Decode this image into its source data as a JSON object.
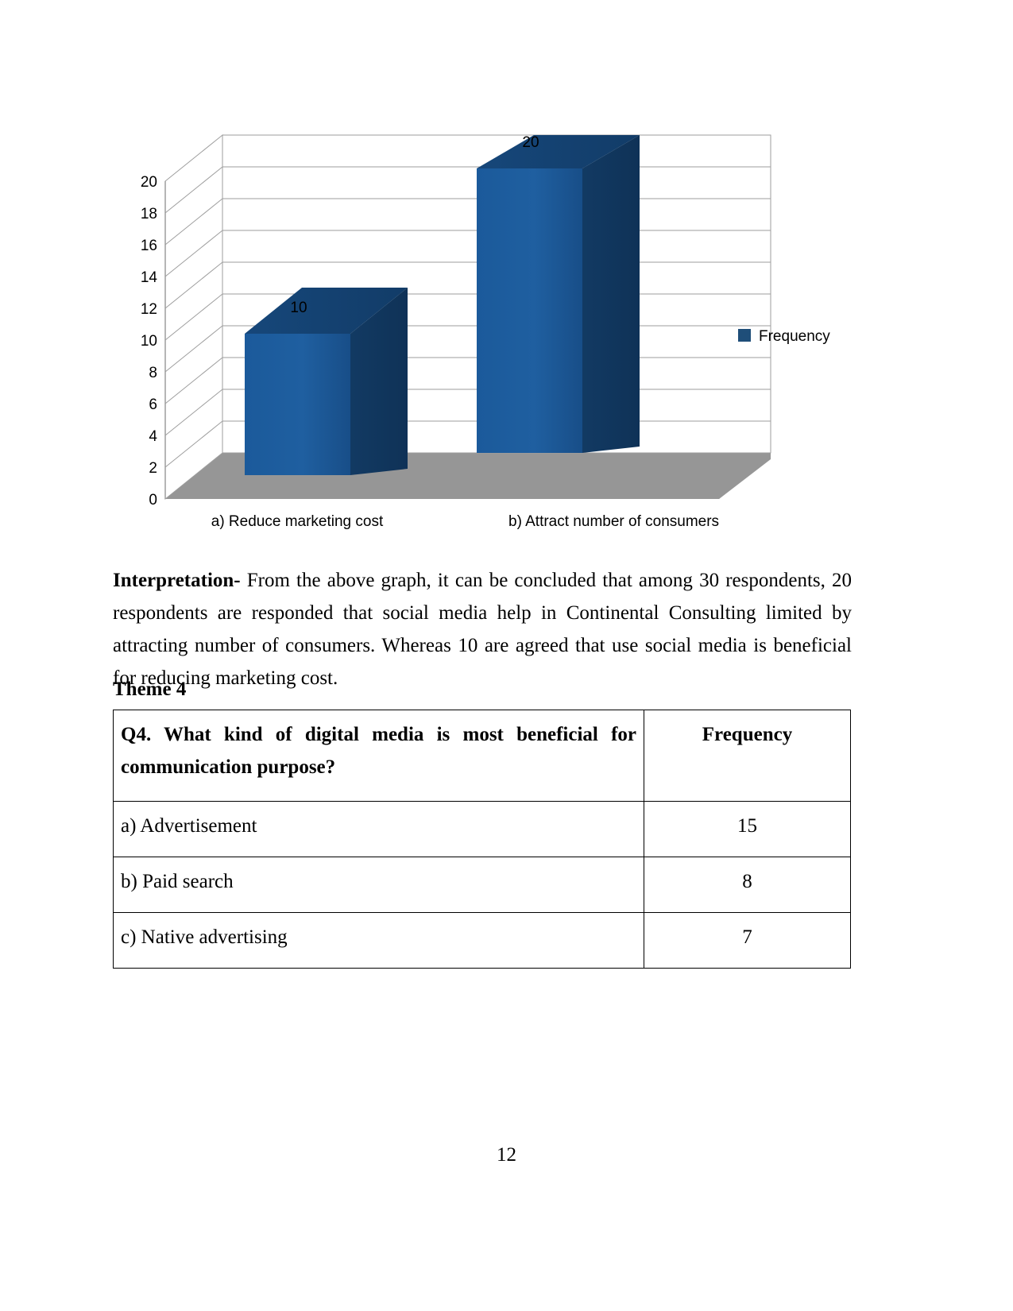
{
  "chart_data": {
    "type": "bar",
    "title": "",
    "subtitle": "",
    "xlabel": "",
    "ylabel": "",
    "categories": [
      "a) Reduce marketing cost",
      "b) Attract number of consumers"
    ],
    "values": [
      10,
      20
    ],
    "data_labels": [
      "10",
      "20"
    ],
    "series": [
      {
        "name": "Frequency",
        "values": [
          10,
          20
        ]
      }
    ],
    "legend": {
      "entries": [
        "Frequency"
      ],
      "position": "right"
    },
    "ylim": [
      0,
      20
    ],
    "yticks": [
      0,
      2,
      4,
      6,
      8,
      10,
      12,
      14,
      16,
      18,
      20
    ],
    "ytick_labels": [
      "0",
      "2",
      "4",
      "6",
      "8",
      "10",
      "12",
      "14",
      "16",
      "18",
      "20"
    ],
    "grid": true,
    "three_d": true,
    "colors": {
      "bar_front": "#1F5FA0",
      "bar_side": "#14406E",
      "bar_top": "#17497E",
      "floor": "#969696",
      "gridline": "#9E9E9E",
      "legend_marker": "#1F4E79"
    }
  },
  "legend": {
    "series_label": "Frequency"
  },
  "interpretation": {
    "label": "Interpretation-",
    "body": " From the above graph, it can be concluded that among 30 respondents, 20 respondents are responded that social media help in Continental Consulting limited by attracting number of consumers. Whereas 10 are agreed that use social media is beneficial for reducing marketing cost."
  },
  "theme": {
    "heading": "Theme 4"
  },
  "table": {
    "header": {
      "question": "Q4. What kind of digital media is most beneficial for communication purpose?",
      "frequency": "Frequency"
    },
    "rows": [
      {
        "label": "a) Advertisement",
        "value": "15"
      },
      {
        "label": "b) Paid search",
        "value": "8"
      },
      {
        "label": "c) Native advertising",
        "value": "7"
      }
    ]
  },
  "footer": {
    "page_number": "12"
  }
}
